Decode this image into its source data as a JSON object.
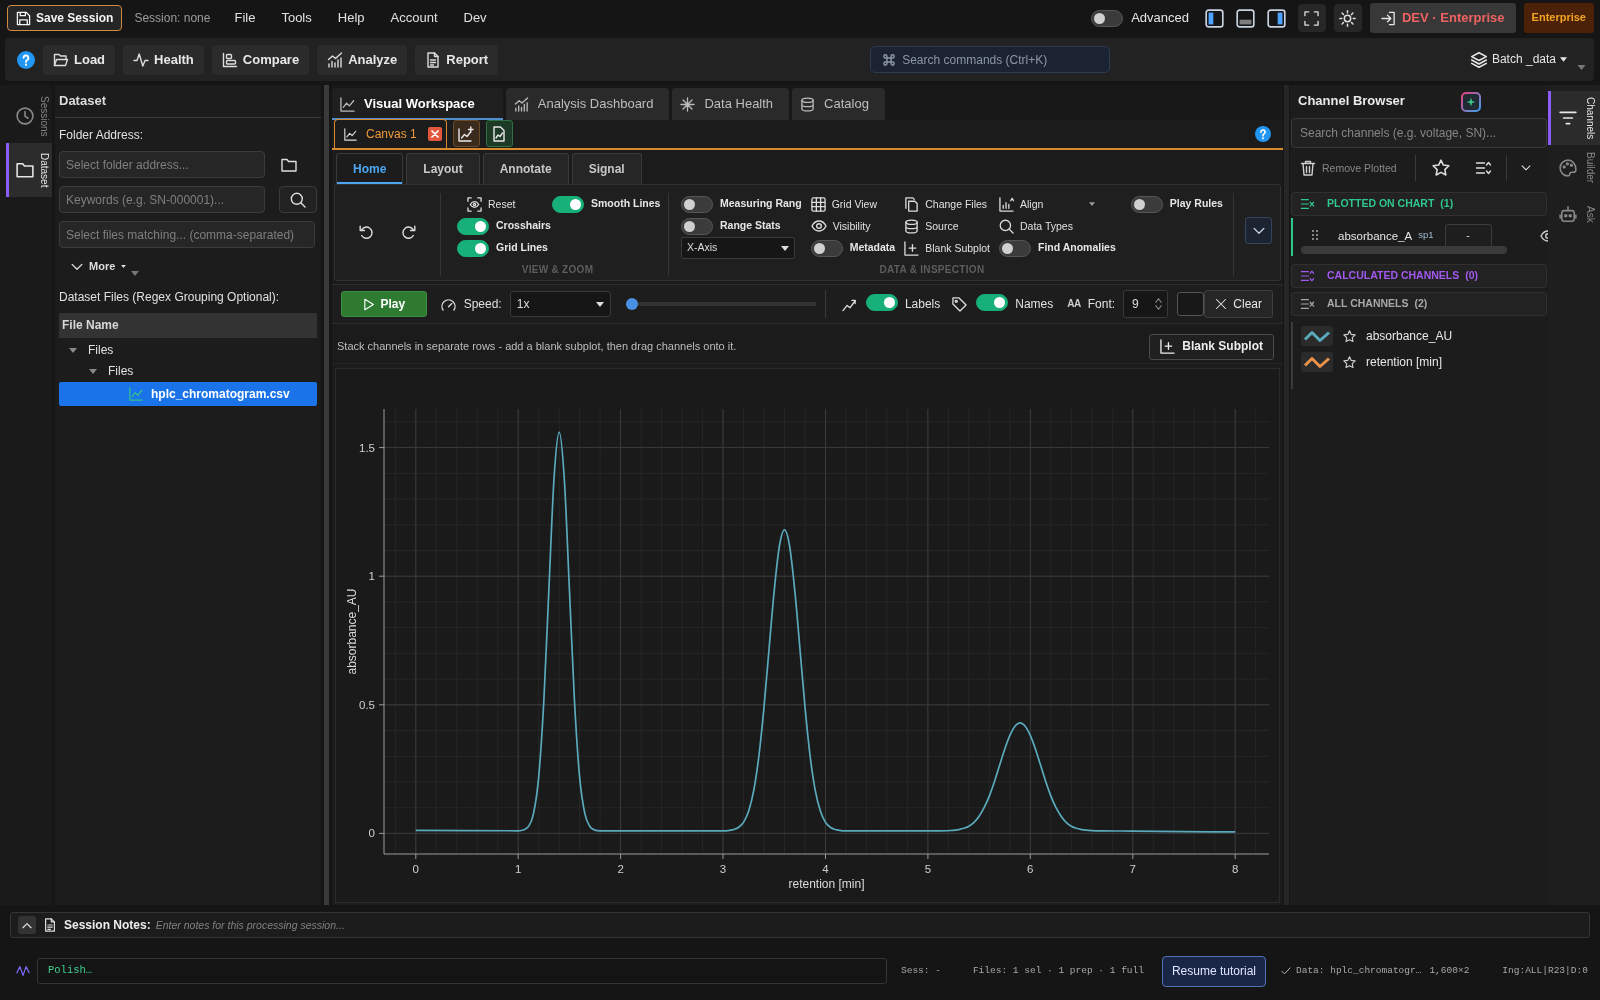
{
  "top_bar": {
    "save_button": "Save Session",
    "session_label": "Session: none",
    "menu": [
      "File",
      "Tools",
      "Help",
      "Account",
      "Dev"
    ],
    "advanced": {
      "label": "Advanced",
      "on": false
    },
    "panel_toggles": [
      {
        "kind": "left",
        "on": true
      },
      {
        "kind": "bottom",
        "on": false
      },
      {
        "kind": "right",
        "on": true
      }
    ],
    "environment_button": "DEV · Enterprise",
    "license_badge": "Enterprise"
  },
  "toolbar": {
    "buttons": [
      "Load",
      "Health",
      "Compare",
      "Analyze",
      "Report"
    ],
    "command_search": {
      "placeholder": "Search commands (Ctrl+K)"
    },
    "dataset_menu": "Batch _data"
  },
  "left_rail": [
    {
      "label": "Sessions",
      "selected": false
    },
    {
      "label": "Dataset",
      "selected": true
    }
  ],
  "dataset_panel": {
    "title": "Dataset",
    "folder_label": "Folder Address:",
    "folder_field": {
      "placeholder": "Select folder address..."
    },
    "keywords_field": {
      "placeholder": "Keywords (e.g. SN-000001)..."
    },
    "match_field": {
      "placeholder": "Select files matching... (comma-separated)"
    },
    "more_button": "More",
    "files_label": "Dataset Files (Regex Grouping Optional):",
    "file_table": {
      "column": "File Name",
      "rows": [
        {
          "label": "Files",
          "expanded": true,
          "children": [
            {
              "label": "Files",
              "expanded": true,
              "children": [
                {
                  "label": "hplc_chromatogram.csv",
                  "selected": true
                }
              ]
            }
          ]
        }
      ]
    }
  },
  "workspace_tabs": [
    {
      "label": "Visual Workspace",
      "selected": true
    },
    {
      "label": "Analysis Dashboard",
      "selected": false
    },
    {
      "label": "Data Health",
      "selected": false
    },
    {
      "label": "Catalog",
      "selected": false
    }
  ],
  "canvas_tabs": [
    {
      "label": "Canvas 1",
      "selected": true
    }
  ],
  "ribbon_tabs": [
    {
      "label": "Home",
      "selected": true
    },
    {
      "label": "Layout",
      "selected": false
    },
    {
      "label": "Annotate",
      "selected": false
    },
    {
      "label": "Signal",
      "selected": false
    }
  ],
  "ribbon": {
    "view_zoom": {
      "caption": "VIEW & ZOOM",
      "reset_button": "Reset",
      "toggles": [
        {
          "label": "Smooth Lines",
          "on": true
        },
        {
          "label": "Crosshairs",
          "on": true
        },
        {
          "label": "Grid Lines",
          "on": true
        }
      ]
    },
    "data_inspection": {
      "caption": "DATA & INSPECTION",
      "columns": [
        [
          {
            "kind": "toggle",
            "label": "Measuring Rang",
            "on": false
          },
          {
            "kind": "toggle",
            "label": "Range Stats",
            "on": false
          },
          {
            "kind": "select",
            "value": "X-Axis"
          }
        ],
        [
          {
            "kind": "button",
            "label": "Grid View"
          },
          {
            "kind": "button",
            "label": "Visibility"
          },
          {
            "kind": "toggle",
            "label": "Metadata",
            "on": false
          }
        ],
        [
          {
            "kind": "button",
            "label": "Change Files"
          },
          {
            "kind": "button",
            "label": "Source"
          },
          {
            "kind": "button",
            "label": "Blank Subplot"
          }
        ],
        [
          {
            "kind": "dropdown",
            "label": "Align"
          },
          {
            "kind": "button",
            "label": "Data Types"
          },
          {
            "kind": "toggle",
            "label": "Find Anomalies",
            "on": false
          }
        ],
        [
          {
            "kind": "toggle",
            "label": "Play Rules",
            "on": false
          }
        ]
      ]
    }
  },
  "play_bar": {
    "play_button": "Play",
    "speed_label": "Speed:",
    "speed": "1x",
    "position_slider": {
      "level": 0
    },
    "labels": {
      "label": "Labels",
      "on": true
    },
    "names": {
      "label": "Names",
      "on": true
    },
    "font_glyph": "AA",
    "font_label": "Font:",
    "font_size": "9",
    "clear_button": "Clear"
  },
  "subplot_hint": {
    "text": "Stack channels in separate rows - add a blank subplot, then drag channels onto it.",
    "button": "Blank Subplot"
  },
  "chart": {
    "chart_data": {
      "type": "line",
      "xlabel": "retention [min]",
      "ylabel": "absorbance_AU",
      "x": [
        0,
        0.5,
        1,
        1.1,
        1.15,
        1.2,
        1.25,
        1.3,
        1.35,
        1.4,
        1.45,
        1.5,
        1.55,
        1.6,
        1.65,
        1.7,
        1.75,
        1.8,
        2,
        2.5,
        3,
        3.05,
        3.1,
        3.15,
        3.2,
        3.25,
        3.3,
        3.35,
        3.4,
        3.45,
        3.5,
        3.55,
        3.6,
        3.65,
        3.7,
        3.75,
        3.8,
        3.85,
        3.9,
        3.95,
        4,
        4.05,
        4.1,
        4.15,
        4.2,
        4.5,
        5,
        5.2,
        5.25,
        5.3,
        5.35,
        5.4,
        5.45,
        5.5,
        5.55,
        5.6,
        5.65,
        5.7,
        5.75,
        5.8,
        5.85,
        5.9,
        5.95,
        6,
        6.05,
        6.1,
        6.15,
        6.2,
        6.25,
        6.3,
        6.35,
        6.4,
        6.45,
        6.5,
        6.6,
        6.7,
        7,
        7.5,
        8
      ],
      "series": [
        {
          "color": "#5aaabd",
          "values": [
            0.012,
            0.011,
            0.01,
            0.027,
            0.078,
            0.22,
            0.513,
            0.95,
            1.378,
            1.56,
            1.378,
            0.95,
            0.513,
            0.22,
            0.078,
            0.027,
            0.013,
            0.01,
            0.01,
            0.01,
            0.01,
            0.011,
            0.015,
            0.023,
            0.043,
            0.087,
            0.168,
            0.301,
            0.491,
            0.72,
            0.947,
            1.117,
            1.18,
            1.117,
            0.947,
            0.72,
            0.491,
            0.301,
            0.168,
            0.087,
            0.043,
            0.023,
            0.015,
            0.011,
            0.01,
            0.01,
            0.01,
            0.011,
            0.012,
            0.015,
            0.02,
            0.028,
            0.043,
            0.067,
            0.101,
            0.146,
            0.202,
            0.265,
            0.327,
            0.381,
            0.417,
            0.43,
            0.417,
            0.381,
            0.327,
            0.265,
            0.202,
            0.146,
            0.101,
            0.067,
            0.043,
            0.028,
            0.02,
            0.015,
            0.011,
            0.01,
            0.009,
            0.007,
            0.006
          ]
        }
      ],
      "xlim": [
        -0.31,
        8.33
      ],
      "ylim": [
        -0.08,
        1.65
      ],
      "xticks": [
        0,
        1,
        2,
        3,
        4,
        5,
        6,
        7,
        8
      ],
      "yticks": [
        0,
        0.5,
        1,
        1.5
      ],
      "grid": true
    }
  },
  "channel_browser": {
    "title": "Channel Browser",
    "search": {
      "placeholder": "Search channels (e.g. voltage, SN)..."
    },
    "remove_button": {
      "label": "Remove Plotted",
      "disabled": true
    },
    "sections": [
      {
        "kind": "plotted",
        "title": "PLOTTED ON CHART",
        "count": "(1)",
        "color": "#2fc78c",
        "items": [
          {
            "name": "absorbance_A",
            "subplot": "sp1",
            "value": "-"
          }
        ]
      },
      {
        "kind": "calculated",
        "title": "CALCULATED CHANNELS",
        "count": "(0)",
        "color": "#a259f0"
      },
      {
        "kind": "all",
        "title": "ALL CHANNELS",
        "count": "(2)",
        "color": "#a8a8a8",
        "items": [
          {
            "name": "absorbance_AU",
            "color": "#5aaabd",
            "starred": false
          },
          {
            "name": "retention [min]",
            "color": "#e8924a",
            "starred": false
          }
        ]
      }
    ]
  },
  "right_rail": [
    {
      "label": "Channels",
      "selected": true
    },
    {
      "label": "Builder",
      "selected": false
    },
    {
      "label": "Ask",
      "selected": false
    }
  ],
  "session_notes": {
    "label": "Session Notes:",
    "placeholder": "Enter notes for this processing session..."
  },
  "status_bar": {
    "message": "Polish…",
    "session": "Sess: -",
    "files": "Files: 1 sel · 1 prep · 1 full",
    "tutorial_button": "Resume tutorial",
    "data": "Data: hplc_chromatogr…",
    "dims": "1,600×2",
    "flags": "Ing:ALL|R23|D:0"
  }
}
